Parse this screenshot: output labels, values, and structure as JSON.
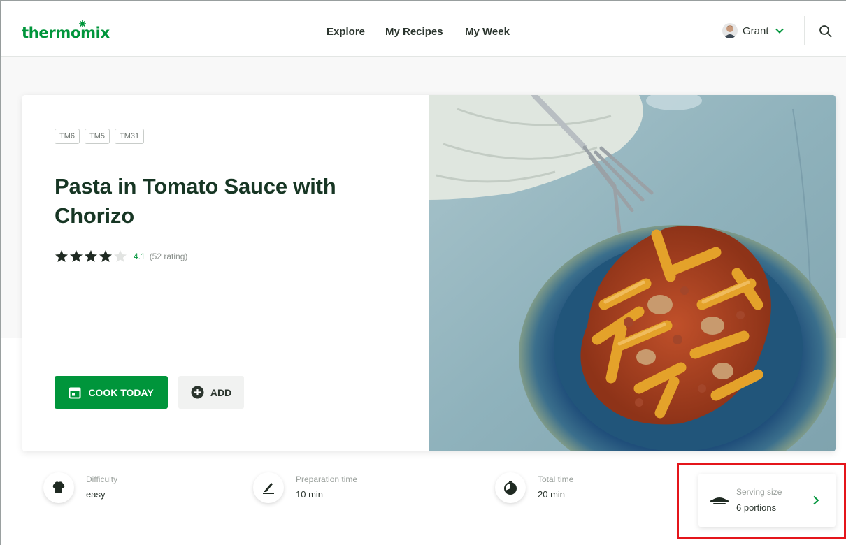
{
  "header": {
    "logo_text": "thermomix",
    "nav": {
      "explore": "Explore",
      "my_recipes": "My Recipes",
      "my_week": "My Week"
    },
    "user_name": "Grant",
    "icons": {
      "search": "search-icon",
      "chevron": "chevron-down-icon",
      "avatar": "avatar"
    }
  },
  "recipe": {
    "tags": [
      "TM6",
      "TM5",
      "TM31"
    ],
    "title": "Pasta in Tomato Sauce with Chorizo",
    "rating": 4.1,
    "rating_value": "4.1",
    "rating_count": "(52 rating)",
    "stars_filled": 4,
    "stars_total": 5,
    "cook_today_label": "COOK TODAY",
    "add_label": "ADD"
  },
  "info": {
    "difficulty": {
      "label": "Difficulty",
      "value": "easy"
    },
    "prep_time": {
      "label": "Preparation time",
      "value": "10 min"
    },
    "total_time": {
      "label": "Total time",
      "value": "20 min"
    },
    "serving": {
      "label": "Serving size",
      "value": "6 portions"
    }
  },
  "colors": {
    "brand": "#00953b",
    "title": "#173624",
    "highlight": "#e4151b"
  }
}
